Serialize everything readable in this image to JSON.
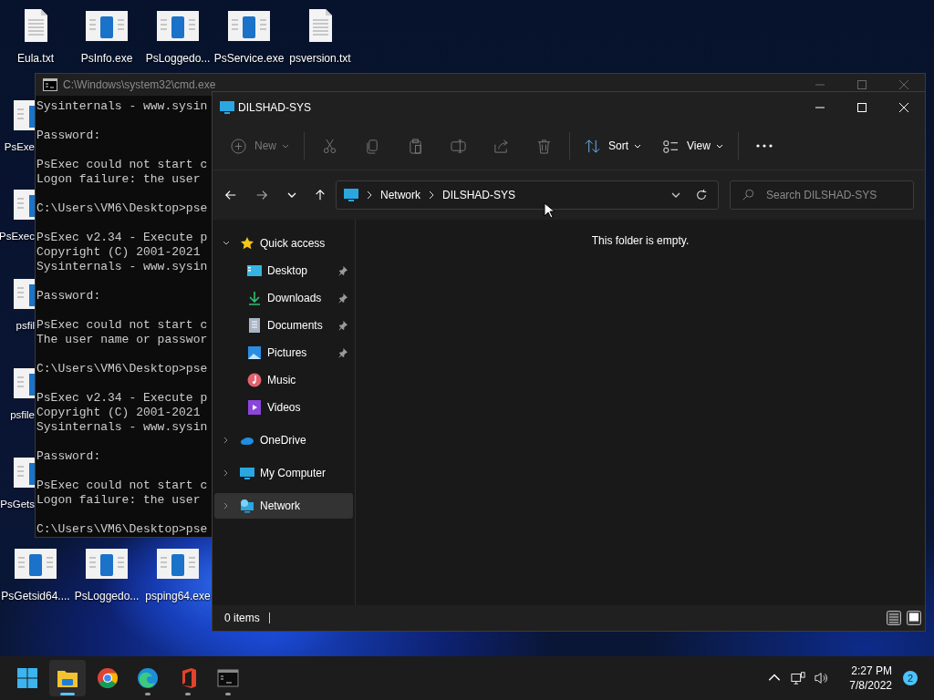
{
  "desktop": {
    "top_row": [
      {
        "label": "Eula.txt",
        "kind": "text"
      },
      {
        "label": "PsInfo.exe",
        "kind": "program"
      },
      {
        "label": "PsLoggedo...",
        "kind": "program"
      },
      {
        "label": "PsService.exe",
        "kind": "program"
      },
      {
        "label": "psversion.txt",
        "kind": "text"
      }
    ],
    "left_column": [
      {
        "label": "PsExe",
        "kind": "program"
      },
      {
        "label": "PsExec",
        "kind": "program"
      },
      {
        "label": "psfil",
        "kind": "program"
      },
      {
        "label": "psfile",
        "kind": "program"
      },
      {
        "label": "PsGets",
        "kind": "program"
      }
    ],
    "bottom_row": [
      {
        "label": "PsGetsid64....",
        "kind": "program"
      },
      {
        "label": "PsLoggedo...",
        "kind": "program"
      },
      {
        "label": "psping64.exe",
        "kind": "program"
      }
    ]
  },
  "console_window": {
    "title": "C:\\Windows\\system32\\cmd.exe",
    "blocks": [
      [
        "Sysinternals - www.sysin"
      ],
      [
        "Password:"
      ],
      [
        "PsExec could not start c",
        "Logon failure: the user"
      ],
      [
        "C:\\Users\\VM6\\Desktop>pse"
      ],
      [
        "PsExec v2.34 - Execute p",
        "Copyright (C) 2001-2021",
        "Sysinternals - www.sysin"
      ],
      [
        "Password:"
      ],
      [
        "PsExec could not start c",
        "The user name or passwor"
      ],
      [
        "C:\\Users\\VM6\\Desktop>pse"
      ],
      [
        "PsExec v2.34 - Execute p",
        "Copyright (C) 2001-2021",
        "Sysinternals - www.sysin"
      ],
      [
        "Password:"
      ],
      [
        "PsExec could not start c",
        "Logon failure: the user"
      ],
      [
        "C:\\Users\\VM6\\Desktop>pse"
      ]
    ]
  },
  "explorer": {
    "title": "DILSHAD-SYS",
    "toolbar": [
      {
        "kind": "new",
        "label": "New",
        "disabled": true
      },
      {
        "kind": "cut",
        "disabled": true
      },
      {
        "kind": "copy",
        "disabled": true
      },
      {
        "kind": "paste",
        "disabled": true
      },
      {
        "kind": "rename",
        "disabled": true
      },
      {
        "kind": "share",
        "disabled": true
      },
      {
        "kind": "delete",
        "disabled": true
      },
      {
        "kind": "sort",
        "label": "Sort",
        "disabled": false
      },
      {
        "kind": "view",
        "label": "View",
        "disabled": false
      },
      {
        "kind": "more",
        "disabled": false
      }
    ],
    "address": {
      "path": [
        "Network",
        "DILSHAD-SYS"
      ]
    },
    "search": {
      "placeholder": "Search DILSHAD-SYS"
    },
    "nav": [
      {
        "label": "Quick access",
        "kind": "star",
        "expanded": true,
        "selected": false,
        "children": [
          {
            "label": "Desktop",
            "kind": "desktop",
            "pinned": true,
            "selected": false
          },
          {
            "label": "Downloads",
            "kind": "downloads",
            "pinned": true,
            "selected": false
          },
          {
            "label": "Documents",
            "kind": "documents",
            "pinned": true,
            "selected": false
          },
          {
            "label": "Pictures",
            "kind": "pictures",
            "pinned": true,
            "selected": false
          },
          {
            "label": "Music",
            "kind": "music",
            "pinned": false,
            "selected": false
          },
          {
            "label": "Videos",
            "kind": "videos",
            "pinned": false,
            "selected": false
          }
        ]
      },
      {
        "label": "OneDrive",
        "kind": "cloud",
        "expanded": false,
        "selected": false
      },
      {
        "label": "My Computer",
        "kind": "computer",
        "expanded": false,
        "selected": false
      },
      {
        "label": "Network",
        "kind": "network",
        "expanded": false,
        "selected": true
      }
    ],
    "empty_message": "This folder is empty.",
    "status": "0 items"
  },
  "taskbar": {
    "apps": [
      {
        "kind": "start",
        "running": false,
        "selected": false
      },
      {
        "kind": "explorer",
        "running": true,
        "selected": true
      },
      {
        "kind": "chrome",
        "running": false,
        "selected": false
      },
      {
        "kind": "edge",
        "running": true,
        "selected": false
      },
      {
        "kind": "office",
        "running": true,
        "selected": false
      },
      {
        "kind": "terminal",
        "running": true,
        "selected": false
      }
    ],
    "time": "2:27 PM",
    "date": "7/8/2022",
    "notifications": "2"
  }
}
